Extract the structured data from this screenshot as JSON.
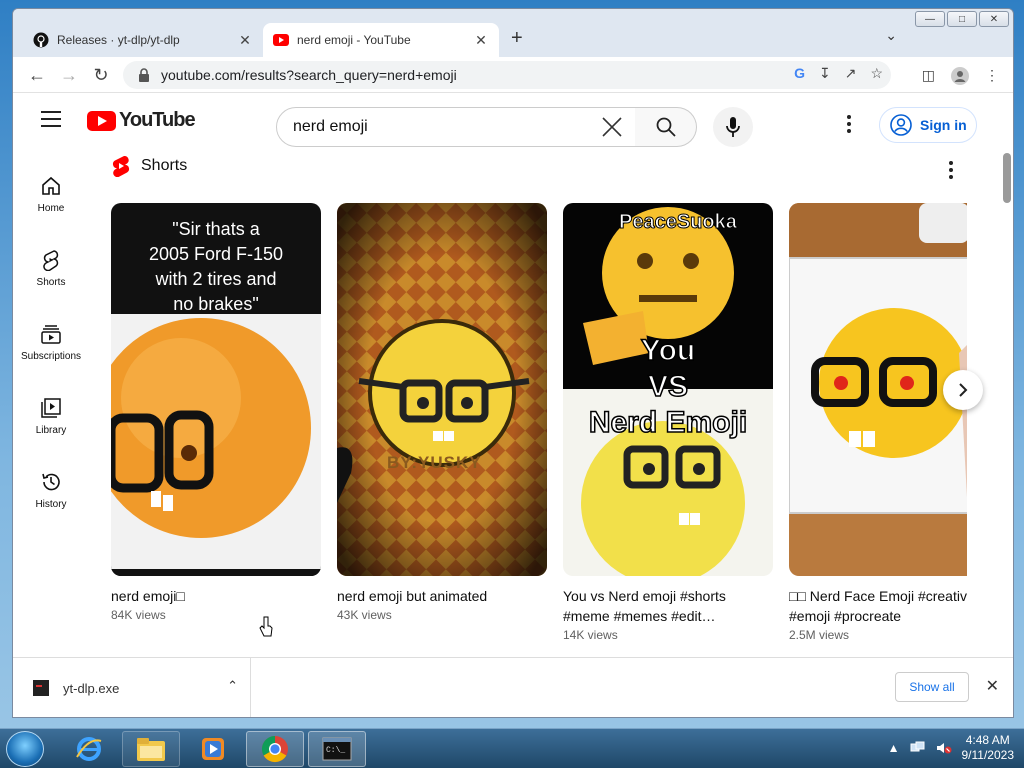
{
  "browser": {
    "tabs": [
      {
        "title": "Releases · yt-dlp/yt-dlp",
        "icon": "github-icon",
        "active": false
      },
      {
        "title": "nerd emoji - YouTube",
        "icon": "youtube-icon",
        "active": true
      }
    ],
    "address": "youtube.com/results?search_query=nerd+emoji",
    "accent": "#1a73e8"
  },
  "youtube": {
    "logo_text": "YouTube",
    "search_value": "nerd emoji",
    "sign_in_label": "Sign in",
    "guide": [
      {
        "label": "Home",
        "icon": "home-icon"
      },
      {
        "label": "Shorts",
        "icon": "shorts-icon"
      },
      {
        "label": "Subscriptions",
        "icon": "subscriptions-icon"
      },
      {
        "label": "Library",
        "icon": "library-icon"
      },
      {
        "label": "History",
        "icon": "history-icon"
      }
    ],
    "shelf_title": "Shorts",
    "shorts": [
      {
        "title": "nerd emoji□",
        "views": "84K views",
        "overlay": [
          "\"Sir thats a",
          "2005 Ford F-150",
          "with 2 tires and",
          "no brakes\""
        ]
      },
      {
        "title": "nerd emoji but animated",
        "views": "43K views",
        "overlay": [
          "BY:YUSKY"
        ]
      },
      {
        "title": "You vs Nerd emoji #shorts #meme #memes #edit…",
        "views": "14K views",
        "overlay": [
          "PeaceSuoka",
          "You",
          "VS",
          "Nerd Emoji"
        ]
      },
      {
        "title": "□□ Nerd Face Emoji #creative #emoji #procreate",
        "views": "2.5M views",
        "overlay": []
      }
    ],
    "brand_color": "#ff0000",
    "link_color": "#065fd4"
  },
  "downloads": {
    "file_name": "yt-dlp.exe",
    "show_all_label": "Show all"
  },
  "taskbar": {
    "time": "4:48 AM",
    "date": "9/11/2023",
    "apps": [
      "internet-explorer-icon",
      "windows-explorer-icon",
      "media-player-icon",
      "chrome-icon",
      "command-prompt-icon"
    ]
  }
}
